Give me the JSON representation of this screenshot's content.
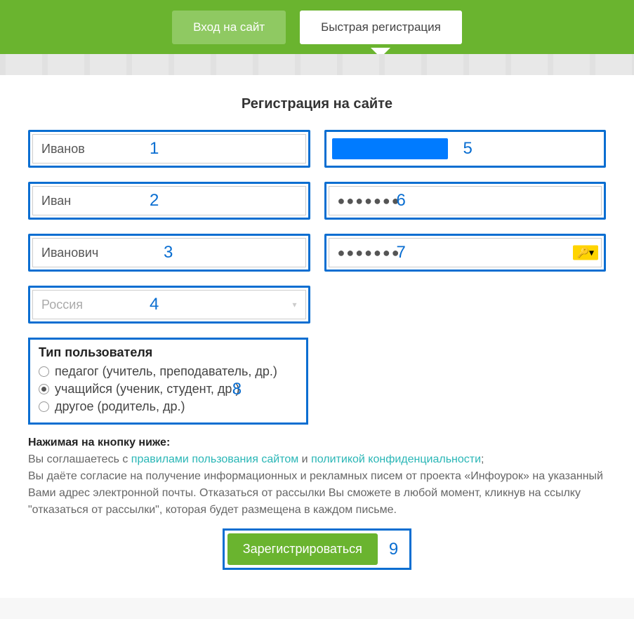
{
  "tabs": {
    "login": "Вход на сайт",
    "register": "Быстрая регистрация"
  },
  "form": {
    "title": "Регистрация на сайте",
    "lastname": {
      "value": "Иванов",
      "num": "1"
    },
    "firstname": {
      "value": "Иван",
      "num": "2"
    },
    "patronymic": {
      "value": "Иванович",
      "num": "3"
    },
    "country": {
      "value": "Россия",
      "num": "4"
    },
    "email": {
      "num": "5"
    },
    "password": {
      "value": "●●●●●●●",
      "num": "6"
    },
    "password_confirm": {
      "value": "●●●●●●●",
      "num": "7"
    }
  },
  "user_type": {
    "title": "Тип пользователя",
    "options": [
      {
        "label": "педагог (учитель, преподаватель, др.)",
        "checked": false
      },
      {
        "label": "учащийся (ученик, студент, др.)",
        "checked": true
      },
      {
        "label": "другое (родитель, др.)",
        "checked": false
      }
    ],
    "num": "8"
  },
  "consent": {
    "bold": "Нажимая на кнопку ниже:",
    "line1_a": "Вы соглашаетесь с ",
    "link1": "правилами пользования сайтом",
    "line1_b": " и ",
    "link2": "политикой конфиденциальности",
    "line1_c": ";",
    "line2": "Вы даёте согласие на получение информационных и рекламных писем от проекта «Инфоурок» на указанный Вами адрес электронной почты. Отказаться от рассылки Вы сможете в любой момент, кликнув на ссылку \"отказаться от рассылки\", которая будет размещена в каждом письме."
  },
  "submit": {
    "label": "Зарегистрироваться",
    "num": "9"
  }
}
